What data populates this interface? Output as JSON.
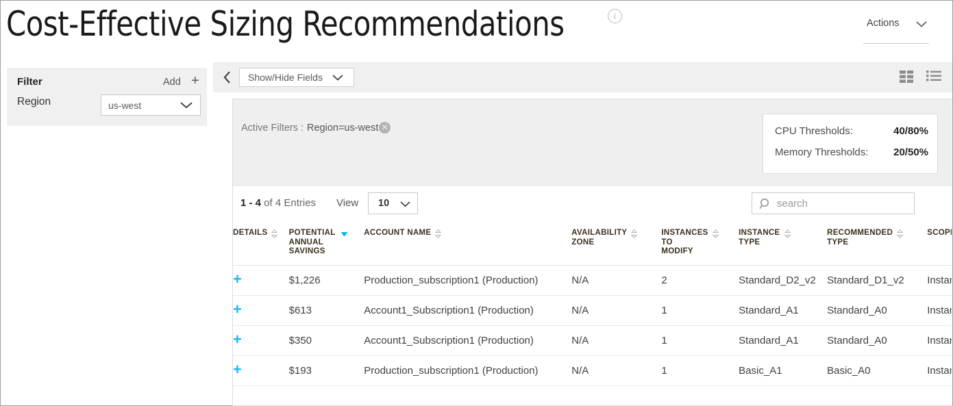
{
  "header": {
    "title": "Cost-Effective Sizing Recommendations",
    "info_icon": "info-icon",
    "actions_label": "Actions",
    "actions_chevron": "chevron-down-icon"
  },
  "filter_panel": {
    "title": "Filter",
    "add_label": "Add",
    "add_icon": "plus-icon",
    "region_label": "Region",
    "region_value": "us-west",
    "region_chevron": "chevron-down-icon"
  },
  "toolbar": {
    "collapse_icon": "chevron-left-icon",
    "show_hide_fields": "Show/Hide Fields",
    "show_hide_chevron": "chevron-down-icon",
    "grid_view_icon": "grid-view-icon",
    "list_view_icon": "list-view-icon"
  },
  "active_filters": {
    "label": "Active Filters :",
    "value": "Region=us-west",
    "remove_icon": "close-circle-icon"
  },
  "thresholds": {
    "cpu_label": "CPU Thresholds:",
    "cpu_value": "40/80%",
    "memory_label": "Memory Thresholds:",
    "memory_value": "20/50%"
  },
  "table_controls": {
    "entries_range": "1 - 4",
    "entries_suffix": " of 4 Entries",
    "view_label": "View",
    "page_size": "10",
    "page_size_chevron": "chevron-down-icon",
    "search_placeholder": "search",
    "search_value": "",
    "search_icon": "search-icon"
  },
  "table": {
    "columns": [
      {
        "label": "DETAILS",
        "sort": "none"
      },
      {
        "label": "POTENTIAL\nANNUAL\nSAVINGS",
        "sort": "desc"
      },
      {
        "label": "ACCOUNT NAME",
        "sort": "none"
      },
      {
        "label": "AVAILABILITY\nZONE",
        "sort": "none"
      },
      {
        "label": "INSTANCES\nTO\nMODIFY",
        "sort": "none"
      },
      {
        "label": "INSTANCE\nTYPE",
        "sort": "none"
      },
      {
        "label": "RECOMMENDED\nTYPE",
        "sort": "none"
      },
      {
        "label": "SCOPE",
        "sort": "none"
      }
    ],
    "expand_icon": "plus-icon",
    "rows": [
      {
        "savings": "$1,226",
        "account_name": "Production_subscription1 (Production)",
        "availability_zone": "N/A",
        "instances_to_modify": "2",
        "instance_type": "Standard_D2_v2",
        "recommended_type": "Standard_D1_v2",
        "scope": "Instance"
      },
      {
        "savings": "$613",
        "account_name": "Account1_Subscription1 (Production)",
        "availability_zone": "N/A",
        "instances_to_modify": "1",
        "instance_type": "Standard_A1",
        "recommended_type": "Standard_A0",
        "scope": "Instance"
      },
      {
        "savings": "$350",
        "account_name": "Account1_Subscription1 (Production)",
        "availability_zone": "N/A",
        "instances_to_modify": "1",
        "instance_type": "Standard_A1",
        "recommended_type": "Standard_A0",
        "scope": "Instance"
      },
      {
        "savings": "$193",
        "account_name": "Production_subscription1 (Production)",
        "availability_zone": "N/A",
        "instances_to_modify": "1",
        "instance_type": "Basic_A1",
        "recommended_type": "Basic_A0",
        "scope": "Instance"
      }
    ]
  },
  "colors": {
    "accent_blue": "#1cb9f0",
    "panel_gray": "#f0f0f0",
    "band_gray": "#efefef",
    "header_text": "#3b2e1e"
  }
}
